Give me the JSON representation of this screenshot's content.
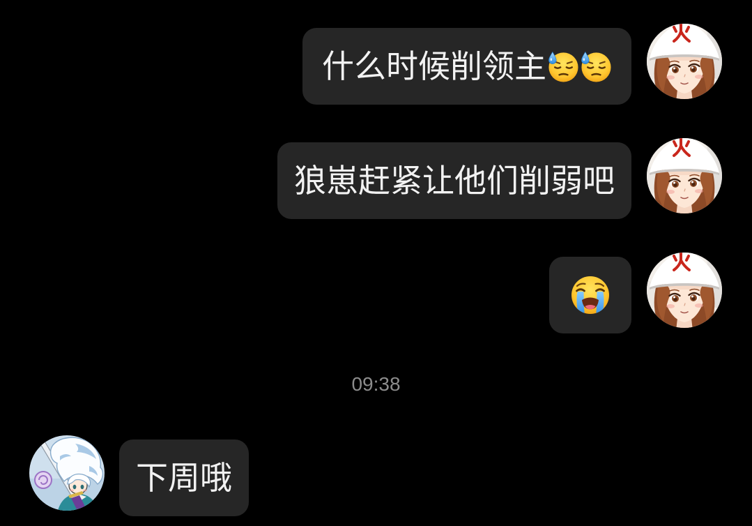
{
  "theme": {
    "background": "#000000",
    "bubble": "#262626",
    "text": "#f2f2f2",
    "timestamp": "#8c8c8c"
  },
  "chat": {
    "items": [
      {
        "text": "什么时候削领主",
        "emoji_icons": [
          "downcast-face-with-sweat-icon",
          "downcast-face-with-sweat-icon"
        ],
        "avatar_icon": "avatar-girl-white-hat-icon"
      },
      {
        "text": "狼崽赶紧让他们削弱吧",
        "avatar_icon": "avatar-girl-white-hat-icon"
      },
      {
        "emoji_icons": [
          "loudly-crying-face-icon"
        ],
        "avatar_icon": "avatar-girl-white-hat-icon"
      },
      {
        "timestamp": "09:38"
      },
      {
        "text": "下周哦",
        "avatar_icon": "avatar-white-haired-swordsman-icon"
      }
    ]
  }
}
